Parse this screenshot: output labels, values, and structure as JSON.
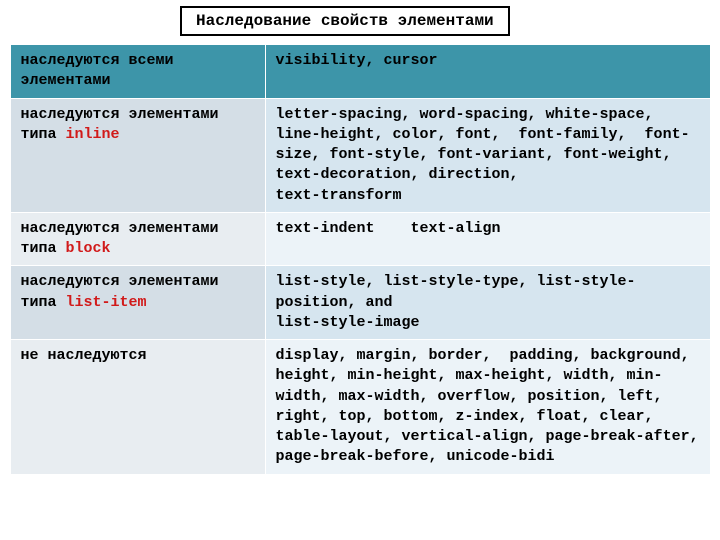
{
  "title": "Наследование свойств элементами",
  "rows": [
    {
      "label_prefix": "наследуются всеми элементами",
      "label_keyword": "",
      "value": "visibility, cursor",
      "header": true
    },
    {
      "label_prefix": "наследуются элементами типа ",
      "label_keyword": "inline",
      "value": "letter-spacing, word-spacing, white-space, line-height, color, font,  font-family,  font-size, font-style, font-variant, font-weight, text-decoration, direction,\ntext-transform"
    },
    {
      "label_prefix": "наследуются элементами типа ",
      "label_keyword": "block",
      "value": "text-indent    text-align"
    },
    {
      "label_prefix": "наследуются элементами типа ",
      "label_keyword": "list-item",
      "value": "list-style, list-style-type, list-style-position, and\nlist-style-image"
    },
    {
      "label_prefix": "не наследуются",
      "label_keyword": "",
      "value": "display, margin, border,  padding, background, height, min-height, max-height, width, min-width, max-width, overflow, position, left, right, top, bottom, z-index, float, clear, table-layout, vertical-align, page-break-after, page-break-before, unicode-bidi"
    }
  ]
}
